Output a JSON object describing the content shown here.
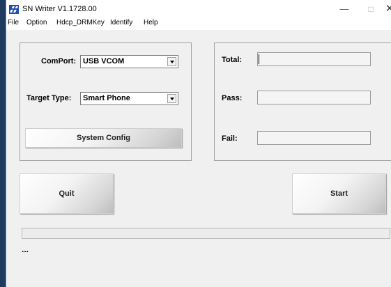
{
  "window": {
    "title": "SN Writer V1.1728.00"
  },
  "window_controls": {
    "minimize": "—",
    "maximize": "□",
    "close": "✕"
  },
  "menu": {
    "items": [
      "File",
      "Option",
      "Hdcp_DRMKey",
      "Identify",
      "Help"
    ]
  },
  "config": {
    "comport": {
      "label": "ComPort:",
      "value": "USB VCOM"
    },
    "target_type": {
      "label": "Target Type:",
      "value": "Smart Phone"
    },
    "system_config_label": "System Config"
  },
  "counters": {
    "total_label": "Total:",
    "pass_label": "Pass:",
    "fail_label": "Fail:"
  },
  "actions": {
    "quit_label": "Quit",
    "start_label": "Start"
  },
  "progress": {
    "value": 0,
    "fill_color": "#06b025"
  },
  "status": {
    "text": "..."
  },
  "icons": {
    "app": "sn-writer-icon",
    "dropdown": "chevron-down-icon"
  }
}
